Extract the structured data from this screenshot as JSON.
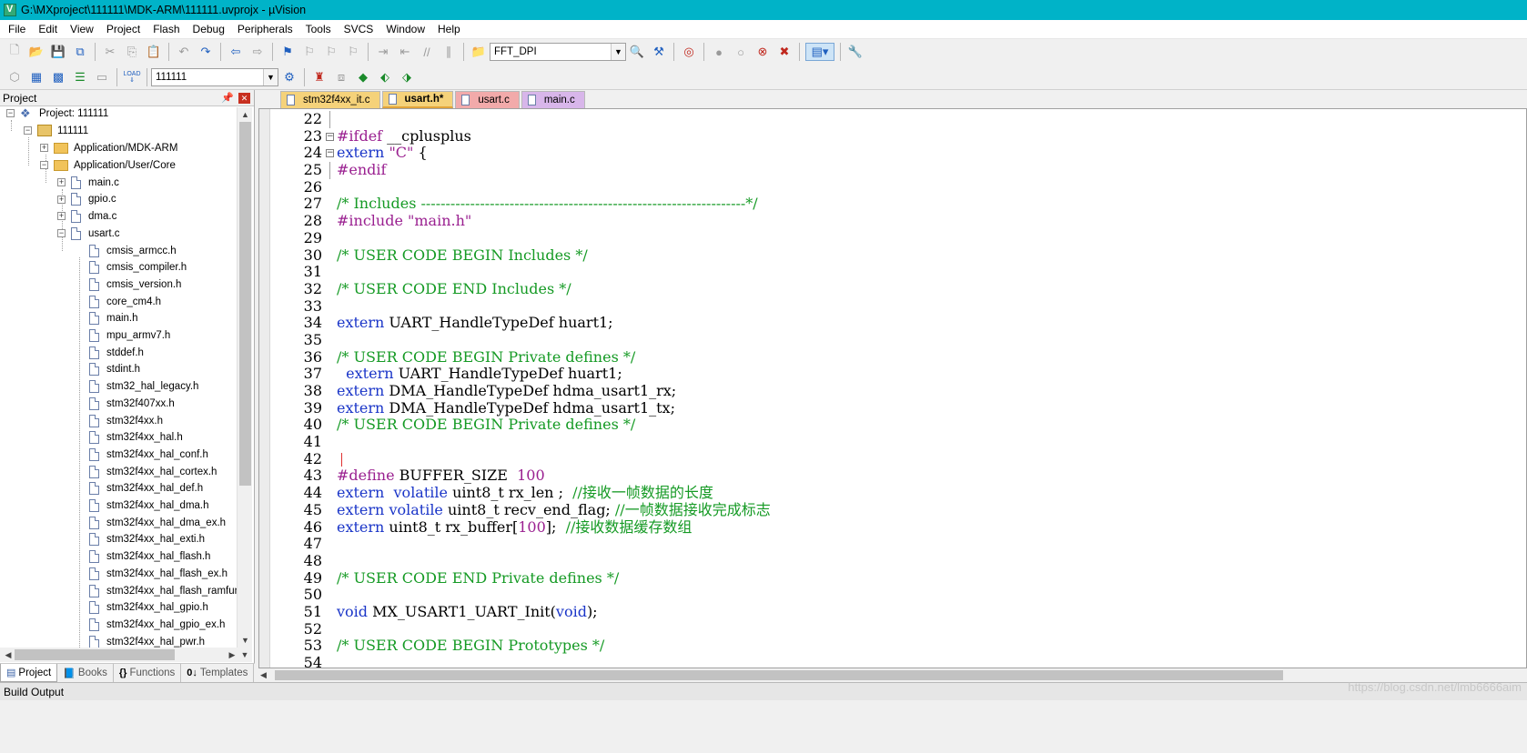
{
  "window": {
    "title": "G:\\MXproject\\111111\\MDK-ARM\\111111.uvprojx - µVision"
  },
  "menu": [
    "File",
    "Edit",
    "View",
    "Project",
    "Flash",
    "Debug",
    "Peripherals",
    "Tools",
    "SVCS",
    "Window",
    "Help"
  ],
  "toolbar": {
    "find_combo_value": "FFT_DPI",
    "target_combo_value": "111111",
    "load_label": "LOAD"
  },
  "project_panel": {
    "title": "Project",
    "root_label": "Project: 111111",
    "target": "111111",
    "groups": [
      {
        "label": "Application/MDK-ARM",
        "expanded": false
      },
      {
        "label": "Application/User/Core",
        "expanded": true
      }
    ],
    "core_files": [
      "main.c",
      "gpio.c",
      "dma.c",
      "usart.c"
    ],
    "usart_deps": [
      "cmsis_armcc.h",
      "cmsis_compiler.h",
      "cmsis_version.h",
      "core_cm4.h",
      "main.h",
      "mpu_armv7.h",
      "stddef.h",
      "stdint.h",
      "stm32_hal_legacy.h",
      "stm32f407xx.h",
      "stm32f4xx.h",
      "stm32f4xx_hal.h",
      "stm32f4xx_hal_conf.h",
      "stm32f4xx_hal_cortex.h",
      "stm32f4xx_hal_def.h",
      "stm32f4xx_hal_dma.h",
      "stm32f4xx_hal_dma_ex.h",
      "stm32f4xx_hal_exti.h",
      "stm32f4xx_hal_flash.h",
      "stm32f4xx_hal_flash_ex.h",
      "stm32f4xx_hal_flash_ramfunc.h",
      "stm32f4xx_hal_gpio.h",
      "stm32f4xx_hal_gpio_ex.h",
      "stm32f4xx_hal_pwr.h"
    ],
    "tabs": [
      "Project",
      "Books",
      "Functions",
      "Templates"
    ]
  },
  "editor": {
    "tabs": [
      {
        "label": "stm32f4xx_it.c",
        "color": "#f5d27a",
        "active": false
      },
      {
        "label": "usart.h*",
        "color": "#f5d27a",
        "active": true
      },
      {
        "label": "usart.c",
        "color": "#f2aaaa",
        "active": false
      },
      {
        "label": "main.c",
        "color": "#d8b6ea",
        "active": false
      }
    ],
    "lines": [
      {
        "n": "22",
        "t": []
      },
      {
        "n": "23",
        "fold": "open",
        "t": [
          [
            "pp",
            "#ifdef"
          ],
          [
            "",
            " __cplusplus"
          ]
        ]
      },
      {
        "n": "24",
        "fold": "open",
        "t": [
          [
            "kw",
            "extern"
          ],
          [
            "",
            " "
          ],
          [
            "st",
            "\"C\""
          ],
          [
            "",
            " {"
          ]
        ]
      },
      {
        "n": "25",
        "t": [
          [
            "pp",
            "#endif"
          ]
        ]
      },
      {
        "n": "26",
        "t": []
      },
      {
        "n": "27",
        "t": [
          [
            "cm",
            "/* Includes ------------------------------------------------------------------*/"
          ]
        ]
      },
      {
        "n": "28",
        "t": [
          [
            "pp",
            "#include"
          ],
          [
            "",
            " "
          ],
          [
            "st",
            "\"main.h\""
          ]
        ]
      },
      {
        "n": "29",
        "t": []
      },
      {
        "n": "30",
        "t": [
          [
            "cm",
            "/* USER CODE BEGIN Includes */"
          ]
        ]
      },
      {
        "n": "31",
        "t": []
      },
      {
        "n": "32",
        "t": [
          [
            "cm",
            "/* USER CODE END Includes */"
          ]
        ]
      },
      {
        "n": "33",
        "t": []
      },
      {
        "n": "34",
        "t": [
          [
            "kw",
            "extern"
          ],
          [
            "",
            " UART_HandleTypeDef huart1;"
          ]
        ]
      },
      {
        "n": "35",
        "t": []
      },
      {
        "n": "36",
        "t": [
          [
            "cm",
            "/* USER CODE BEGIN Private defines */"
          ]
        ]
      },
      {
        "n": "37",
        "t": [
          [
            "",
            "  "
          ],
          [
            "kw",
            "extern"
          ],
          [
            "",
            " UART_HandleTypeDef huart1;"
          ]
        ]
      },
      {
        "n": "38",
        "t": [
          [
            "kw",
            "extern"
          ],
          [
            "",
            " DMA_HandleTypeDef hdma_usart1_rx;"
          ]
        ]
      },
      {
        "n": "39",
        "t": [
          [
            "kw",
            "extern"
          ],
          [
            "",
            " DMA_HandleTypeDef hdma_usart1_tx;"
          ]
        ]
      },
      {
        "n": "40",
        "t": [
          [
            "cm",
            "/* USER CODE BEGIN Private defines */"
          ]
        ]
      },
      {
        "n": "41",
        "t": []
      },
      {
        "n": "42",
        "caret": true,
        "t": []
      },
      {
        "n": "43",
        "t": [
          [
            "pp",
            "#define"
          ],
          [
            "",
            " BUFFER_SIZE  "
          ],
          [
            "st",
            "100"
          ]
        ]
      },
      {
        "n": "44",
        "t": [
          [
            "kw",
            "extern"
          ],
          [
            "",
            "  "
          ],
          [
            "kw",
            "volatile"
          ],
          [
            "",
            " uint8_t rx_len ;  "
          ],
          [
            "cm",
            "//接收一帧数据的长度"
          ]
        ]
      },
      {
        "n": "45",
        "t": [
          [
            "kw",
            "extern"
          ],
          [
            "",
            " "
          ],
          [
            "kw",
            "volatile"
          ],
          [
            "",
            " uint8_t recv_end_flag; "
          ],
          [
            "cm",
            "//一帧数据接收完成标志"
          ]
        ]
      },
      {
        "n": "46",
        "t": [
          [
            "kw",
            "extern"
          ],
          [
            "",
            " uint8_t rx_buffer["
          ],
          [
            "st",
            "100"
          ],
          [
            "",
            "];  "
          ],
          [
            "cm",
            "//接收数据缓存数组"
          ]
        ]
      },
      {
        "n": "47",
        "t": []
      },
      {
        "n": "48",
        "t": []
      },
      {
        "n": "49",
        "t": [
          [
            "cm",
            "/* USER CODE END Private defines */"
          ]
        ]
      },
      {
        "n": "50",
        "t": []
      },
      {
        "n": "51",
        "t": [
          [
            "kw",
            "void"
          ],
          [
            "",
            " MX_USART1_UART_Init("
          ],
          [
            "kw",
            "void"
          ],
          [
            "",
            ");"
          ]
        ]
      },
      {
        "n": "52",
        "t": []
      },
      {
        "n": "53",
        "t": [
          [
            "cm",
            "/* USER CODE BEGIN Prototypes */"
          ]
        ]
      },
      {
        "n": "54",
        "t": []
      }
    ]
  },
  "build_output": {
    "title": "Build Output"
  },
  "watermark": "https://blog.csdn.net/lmb6666aim"
}
